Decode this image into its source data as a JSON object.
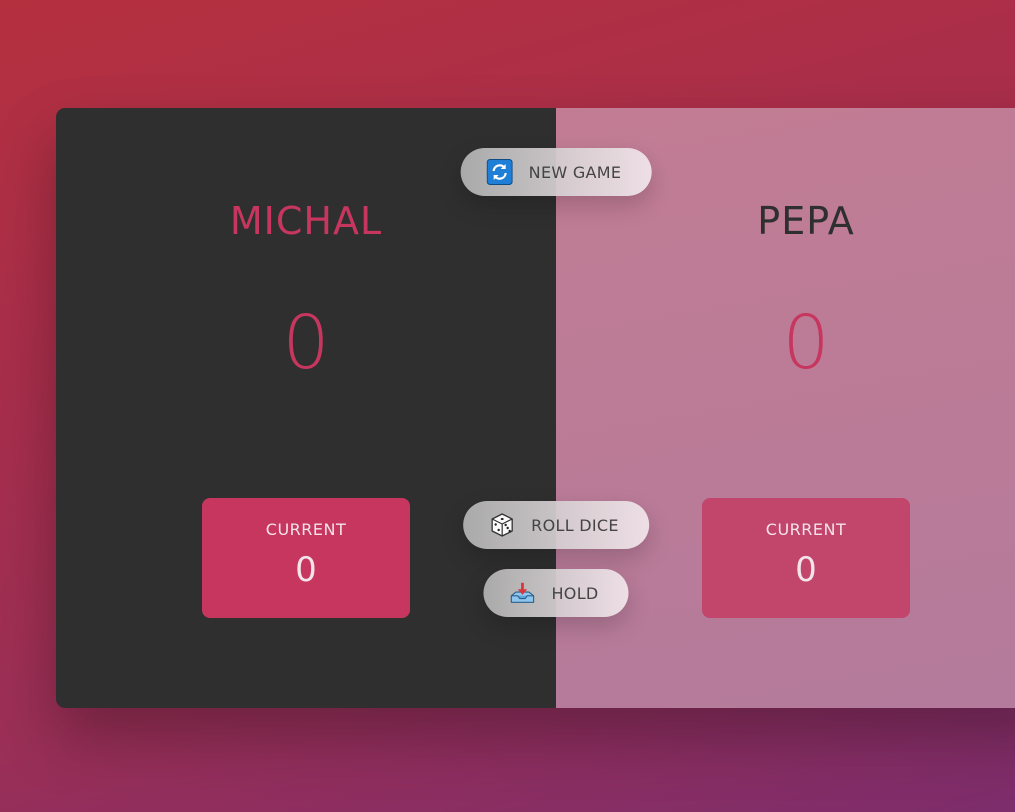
{
  "players": [
    {
      "name": "MICHAL",
      "score": "0",
      "current_label": "CURRENT",
      "current_score": "0",
      "active": true
    },
    {
      "name": "PEPA",
      "score": "0",
      "current_label": "CURRENT",
      "current_score": "0",
      "active": false
    }
  ],
  "buttons": {
    "new_game": {
      "label": "NEW GAME",
      "icon": "refresh-icon"
    },
    "roll_dice": {
      "label": "ROLL DICE",
      "icon": "dice-icon"
    },
    "hold": {
      "label": "HOLD",
      "icon": "inbox-tray-icon"
    }
  },
  "colors": {
    "accent": "#c7365f",
    "active_panel": "#2f2f2f",
    "inactive_panel": "#c27d94"
  }
}
